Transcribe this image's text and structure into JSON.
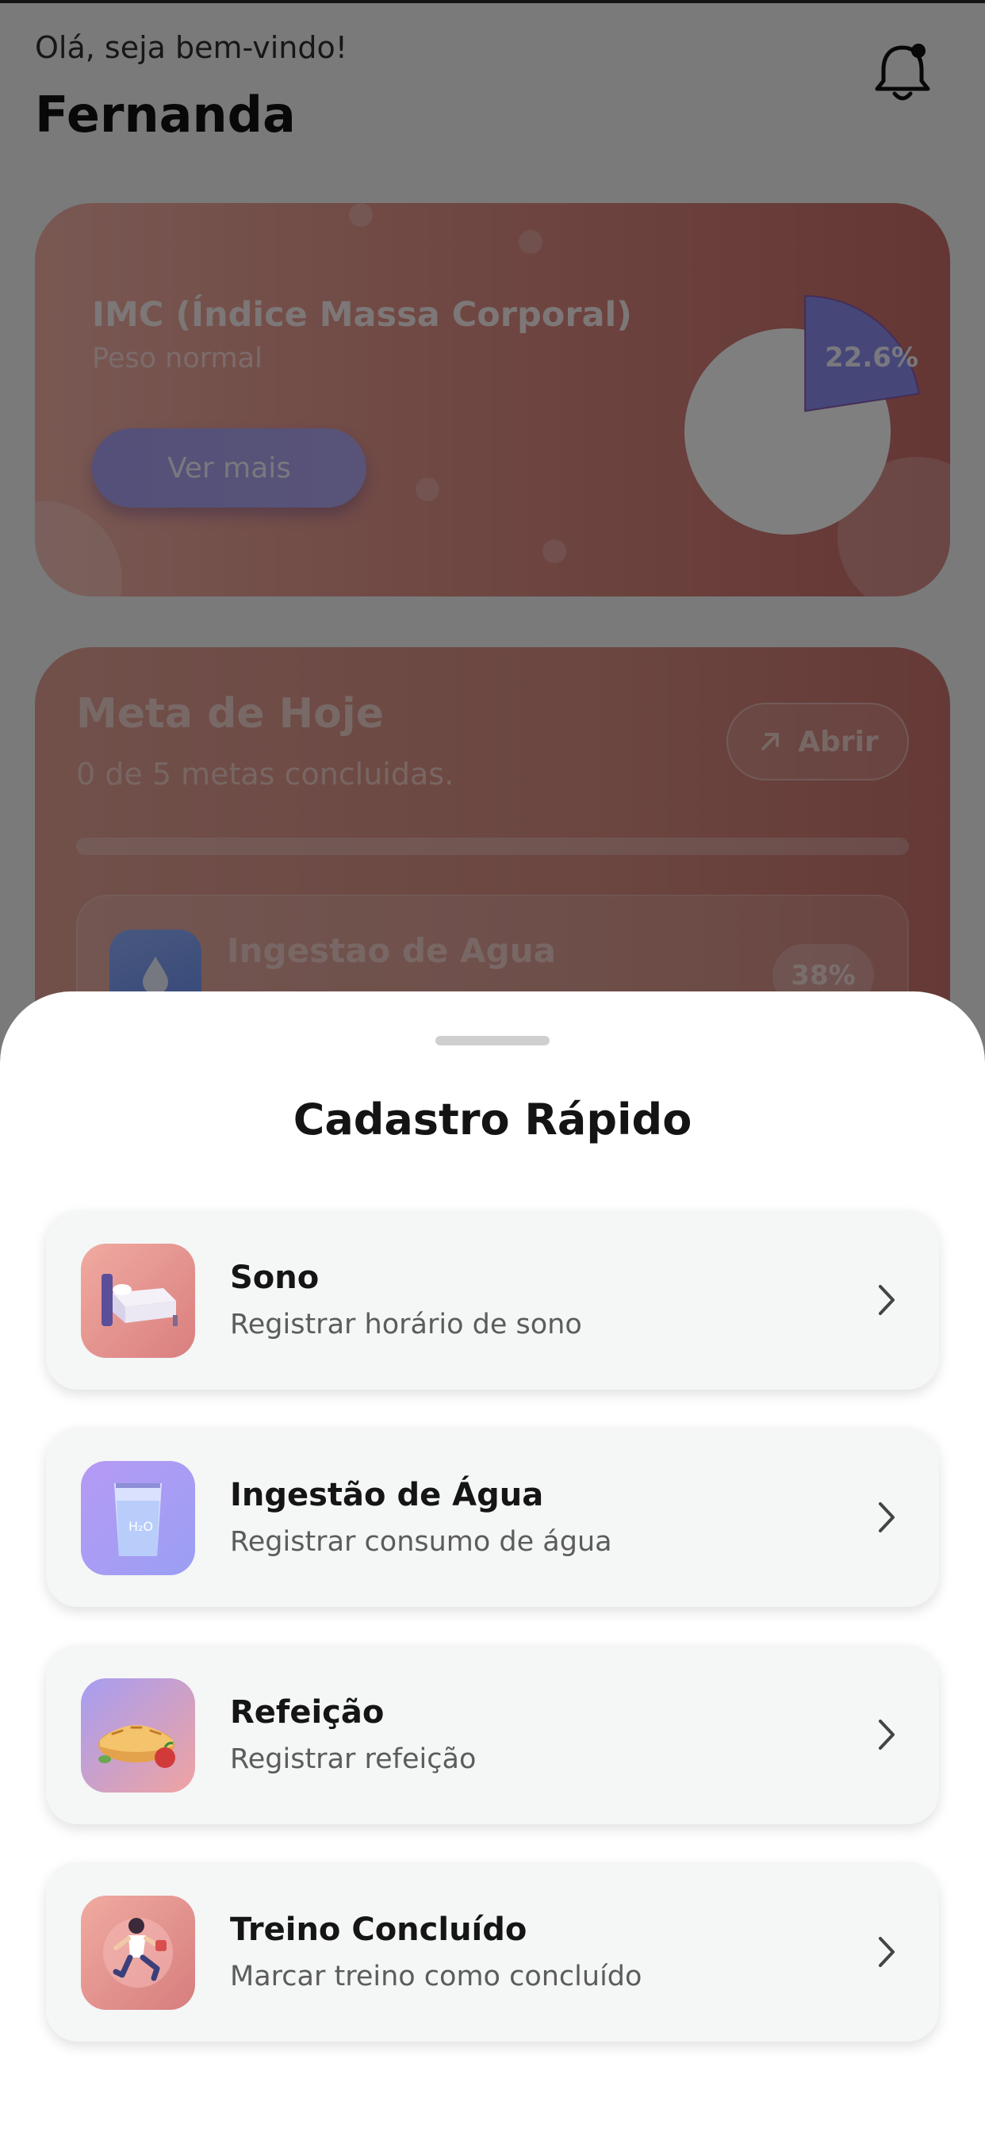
{
  "header": {
    "greeting": "Olá, seja bem-vindo!",
    "user_name": "Fernanda",
    "notification_icon": "bell-icon"
  },
  "imc_card": {
    "title": "IMC (Índice Massa Corporal)",
    "status": "Peso normal",
    "button_label": "Ver mais",
    "chart_percent_label": "22.6%",
    "chart_percent_value": 22.6,
    "colors": {
      "card_gradient_start": "#f3b1a6",
      "card_gradient_end": "#c96d68",
      "slice": "#8d8ff0"
    }
  },
  "meta_card": {
    "title": "Meta de Hoje",
    "subtitle": "0 de 5 metas concluidas.",
    "open_button_label": "Abrir",
    "progress_fraction": 0,
    "item": {
      "title": "Ingestao de Agua",
      "percent_label": "38%",
      "icon": "water-drop-icon"
    }
  },
  "sheet": {
    "title": "Cadastro Rápido",
    "options": [
      {
        "title": "Sono",
        "subtitle": "Registrar horário de sono",
        "icon": "bed-icon"
      },
      {
        "title": "Ingestão de Água",
        "subtitle": "Registrar consumo de água",
        "icon": "water-glass-icon"
      },
      {
        "title": "Refeição",
        "subtitle": "Registrar refeição",
        "icon": "pie-meal-icon"
      },
      {
        "title": "Treino Concluído",
        "subtitle": "Marcar treino como concluído",
        "icon": "workout-icon"
      }
    ]
  }
}
